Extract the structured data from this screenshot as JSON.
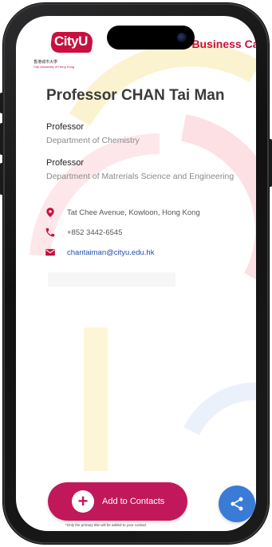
{
  "header": {
    "logo_text": "CityU",
    "logo_cn": "香港城市大學",
    "logo_en": "City University of Hong Kong",
    "card_title": "e-Business Card"
  },
  "profile": {
    "name": "Professor CHAN Tai Man",
    "positions": [
      {
        "title": "Professor",
        "department": "Department of Chemistry"
      },
      {
        "title": "Professor",
        "department": "Department of Matrerials Science and Engineering"
      }
    ]
  },
  "contacts": {
    "address": "Tat Chee Avenue, Kowloon, Hong Kong",
    "phone": "+852 3442-6545",
    "email": "chantaiman@cityu.edu.hk",
    "icons": [
      "location-pin-icon",
      "phone-icon",
      "email-icon"
    ]
  },
  "actions": {
    "add_contacts_label": "Add to Contacts",
    "add_icon": "plus-icon",
    "footnote": "*Only the primary title will be added to your contact",
    "share_icon": "share-icon"
  },
  "colors": {
    "brand": "#c8103e",
    "add_button": "#c1185b",
    "share_button": "#3a7bd5",
    "link": "#1f4fb0"
  }
}
